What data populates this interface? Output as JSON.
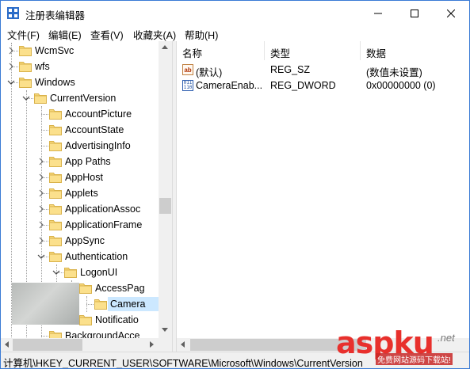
{
  "window": {
    "title": "注册表编辑器"
  },
  "menu": [
    "文件(F)",
    "编辑(E)",
    "查看(V)",
    "收藏夹(A)",
    "帮助(H)"
  ],
  "tree": [
    {
      "label": "WcmSvc",
      "level": 1,
      "chev": "right"
    },
    {
      "label": "wfs",
      "level": 1,
      "chev": "right"
    },
    {
      "label": "Windows",
      "level": 1,
      "chev": "down"
    },
    {
      "label": "CurrentVersion",
      "level": 2,
      "chev": "down"
    },
    {
      "label": "AccountPicture",
      "level": 3,
      "chev": ""
    },
    {
      "label": "AccountState",
      "level": 3,
      "chev": ""
    },
    {
      "label": "AdvertisingInfo",
      "level": 3,
      "chev": ""
    },
    {
      "label": "App Paths",
      "level": 3,
      "chev": "right"
    },
    {
      "label": "AppHost",
      "level": 3,
      "chev": "right"
    },
    {
      "label": "Applets",
      "level": 3,
      "chev": "right"
    },
    {
      "label": "ApplicationAssoc",
      "level": 3,
      "chev": "right"
    },
    {
      "label": "ApplicationFrame",
      "level": 3,
      "chev": "right"
    },
    {
      "label": "AppSync",
      "level": 3,
      "chev": "right"
    },
    {
      "label": "Authentication",
      "level": 3,
      "chev": "down"
    },
    {
      "label": "LogonUI",
      "level": 4,
      "chev": "down"
    },
    {
      "label": "AccessPag",
      "level": 5,
      "chev": "down"
    },
    {
      "label": "Camera",
      "level": 6,
      "chev": "",
      "selected": true
    },
    {
      "label": "Notificatio",
      "level": 5,
      "chev": "right"
    },
    {
      "label": "BackgroundAcce",
      "level": 3,
      "chev": ""
    }
  ],
  "columns": {
    "name": "名称",
    "type": "类型",
    "data": "数据"
  },
  "values": [
    {
      "icon": "ab",
      "name": "(默认)",
      "type": "REG_SZ",
      "data": "(数值未设置)"
    },
    {
      "icon": "bin",
      "name": "CameraEnab...",
      "type": "REG_DWORD",
      "data": "0x00000000 (0)"
    }
  ],
  "status": "计算机\\HKEY_CURRENT_USER\\SOFTWARE\\Microsoft\\Windows\\CurrentVersion",
  "watermark": {
    "main": "aspku",
    "suffix": ".net",
    "sub": "免费网站源码下载站!"
  }
}
